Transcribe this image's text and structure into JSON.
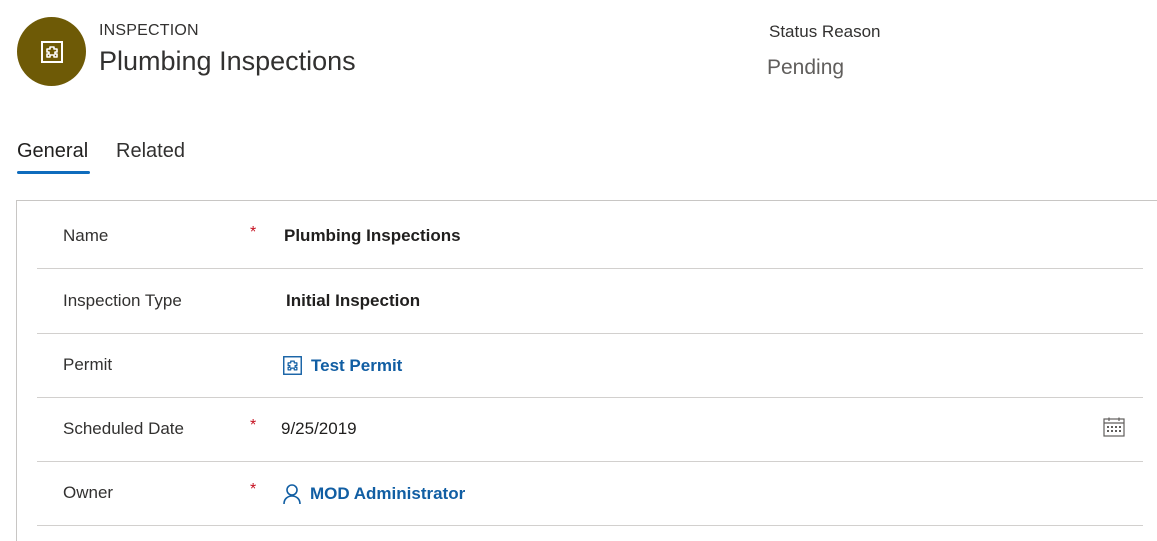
{
  "header": {
    "entity_type": "INSPECTION",
    "title": "Plumbing Inspections",
    "avatar_icon": "permit-icon",
    "avatar_color": "#6e5a06",
    "status_label": "Status Reason",
    "status_value": "Pending"
  },
  "tabs": [
    {
      "label": "General",
      "active": true
    },
    {
      "label": "Related",
      "active": false
    }
  ],
  "accent_color": "#0f6cbd",
  "fields": {
    "name": {
      "label": "Name",
      "required": "*",
      "value": "Plumbing Inspections"
    },
    "inspection_type": {
      "label": "Inspection Type",
      "value": "Initial Inspection"
    },
    "permit": {
      "label": "Permit",
      "value": "Test Permit",
      "icon": "permit-icon"
    },
    "scheduled_date": {
      "label": "Scheduled Date",
      "required": "*",
      "value": "9/25/2019",
      "icon": "calendar-icon"
    },
    "owner": {
      "label": "Owner",
      "required": "*",
      "value": "MOD Administrator",
      "icon": "user-icon"
    }
  }
}
